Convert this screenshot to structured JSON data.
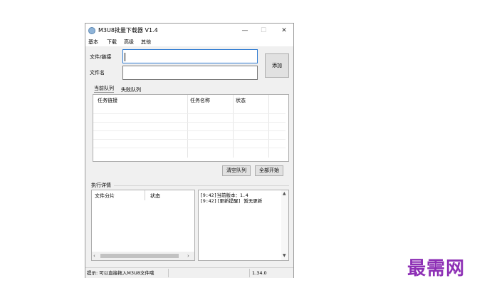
{
  "window": {
    "title": "M3U8批量下载器 V1.4",
    "controls": {
      "minimize": "—",
      "maximize": "☐",
      "close": "✕"
    }
  },
  "menu": [
    "基本",
    "下载",
    "高级",
    "其他"
  ],
  "form": {
    "url_label": "文件/链接",
    "name_label": "文件名",
    "url_value": "",
    "name_value": "",
    "add_button": "添加"
  },
  "queue": {
    "tabs": [
      "当前队列",
      "失败队列"
    ],
    "columns": [
      "任务链接",
      "任务名称",
      "状态"
    ],
    "clear_button": "清空队列",
    "start_all_button": "全部开始"
  },
  "details": {
    "section_title": "执行详情",
    "columns": [
      "文件分片",
      "状态"
    ],
    "log_lines": [
      "[9:42]当前版本：1.4",
      "[9:42][更新提醒] 暂无更新"
    ]
  },
  "statusbar": {
    "hint": "提示: 可以直接拖入M3U8文件哦",
    "version": "1.34.0"
  },
  "watermark": "最需网"
}
